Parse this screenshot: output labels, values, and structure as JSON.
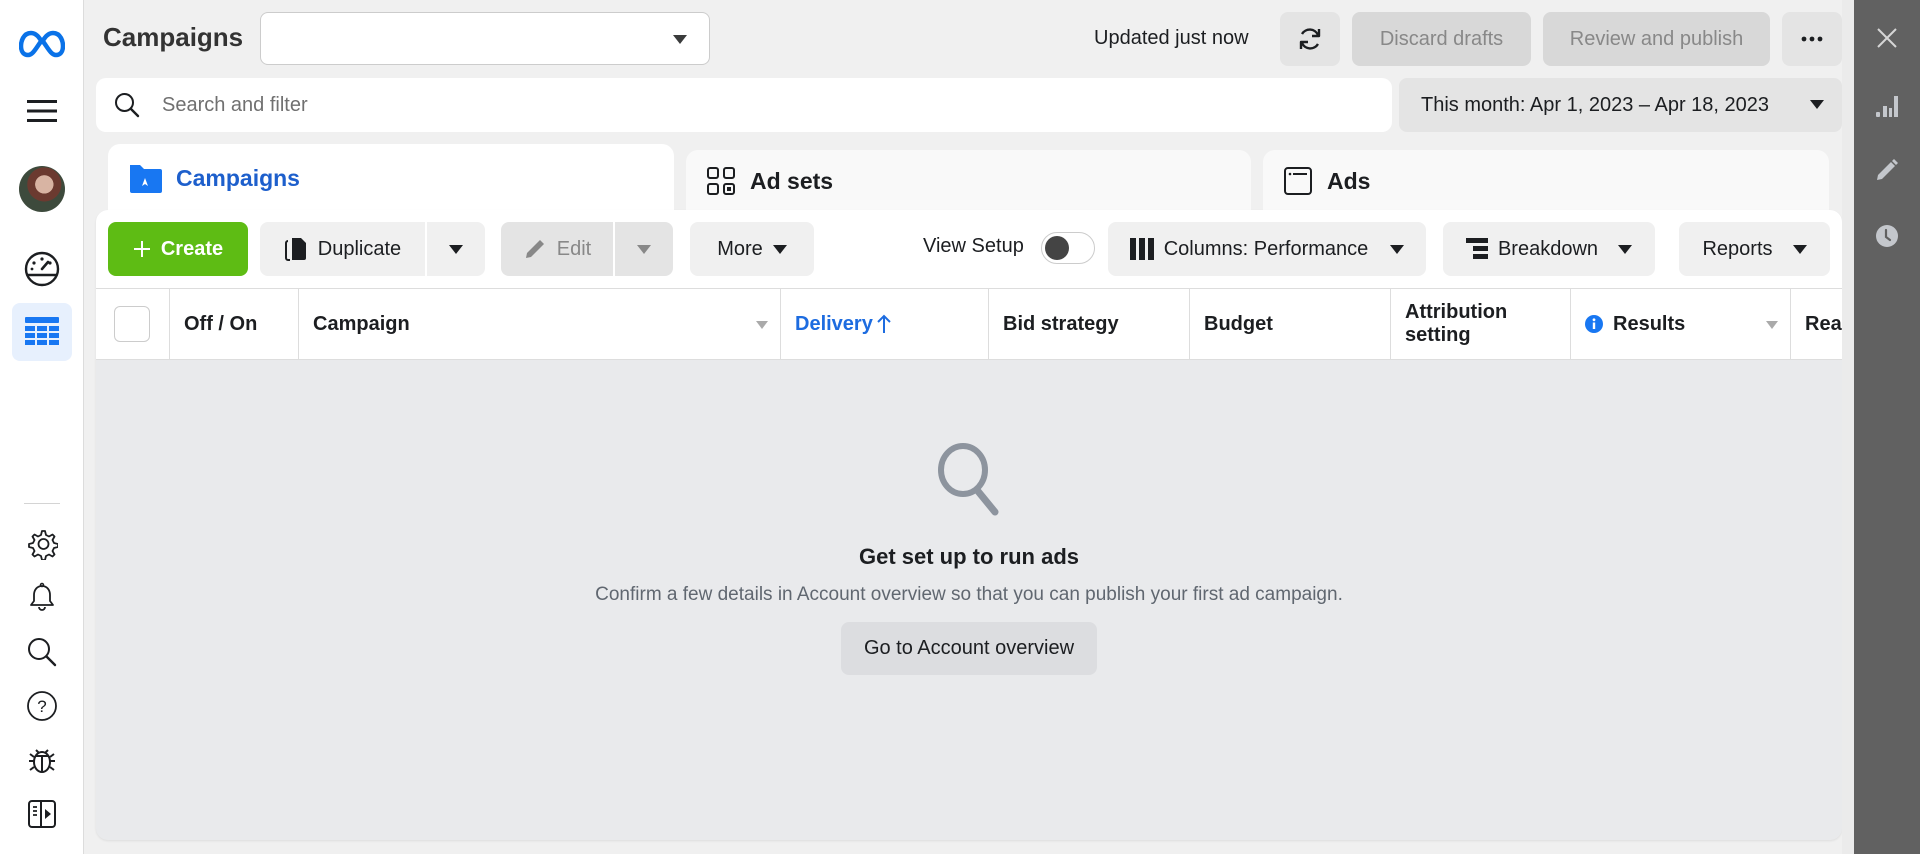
{
  "header": {
    "title": "Campaigns",
    "account_select_value": "",
    "updated_text": "Updated just now",
    "discard_label": "Discard drafts",
    "review_label": "Review and publish",
    "more_icon": "ellipsis-icon",
    "refresh_icon": "refresh-icon"
  },
  "search": {
    "placeholder": "Search and filter",
    "value": ""
  },
  "date_range": {
    "label": "This month: Apr 1, 2023 – Apr 18, 2023"
  },
  "tabs": [
    {
      "label": "Campaigns",
      "icon": "campaign-folder-icon",
      "active": true
    },
    {
      "label": "Ad sets",
      "icon": "adsets-grid-icon",
      "active": false
    },
    {
      "label": "Ads",
      "icon": "ad-window-icon",
      "active": false
    }
  ],
  "toolbar": {
    "create_label": "Create",
    "duplicate_label": "Duplicate",
    "edit_label": "Edit",
    "more_label": "More",
    "view_setup_label": "View Setup",
    "view_setup_on": false,
    "columns_label": "Columns: Performance",
    "breakdown_label": "Breakdown",
    "reports_label": "Reports"
  },
  "table": {
    "columns": [
      {
        "label": ""
      },
      {
        "label": "Off / On"
      },
      {
        "label": "Campaign"
      },
      {
        "label": "Delivery",
        "sorted": "ascending"
      },
      {
        "label": "Bid strategy"
      },
      {
        "label": "Budget"
      },
      {
        "label": "Attribution setting"
      },
      {
        "label": "Results"
      },
      {
        "label": "Reach"
      }
    ],
    "rows": []
  },
  "empty_state": {
    "title": "Get set up to run ads",
    "message": "Confirm a few details in Account overview so that you can publish your first ad campaign.",
    "button_label": "Go to Account overview"
  },
  "left_nav": {
    "items": [
      "meta-logo-icon",
      "menu-icon",
      "avatar",
      "dashboard-gauge-icon",
      "campaigns-table-icon",
      "settings-gear-icon",
      "notifications-bell-icon",
      "search-icon",
      "help-icon",
      "bug-report-icon",
      "collapse-panel-icon"
    ],
    "active": "campaigns-table-icon"
  },
  "right_rail": {
    "items": [
      "close-icon",
      "chart-icon",
      "edit-pencil-icon",
      "history-clock-icon"
    ]
  },
  "colors": {
    "brand_blue": "#0668e1",
    "active_tab_text": "#1d5fcc",
    "create_green": "#5ebc14",
    "sorted_column": "#1d6ce0",
    "right_rail": "#616161"
  }
}
